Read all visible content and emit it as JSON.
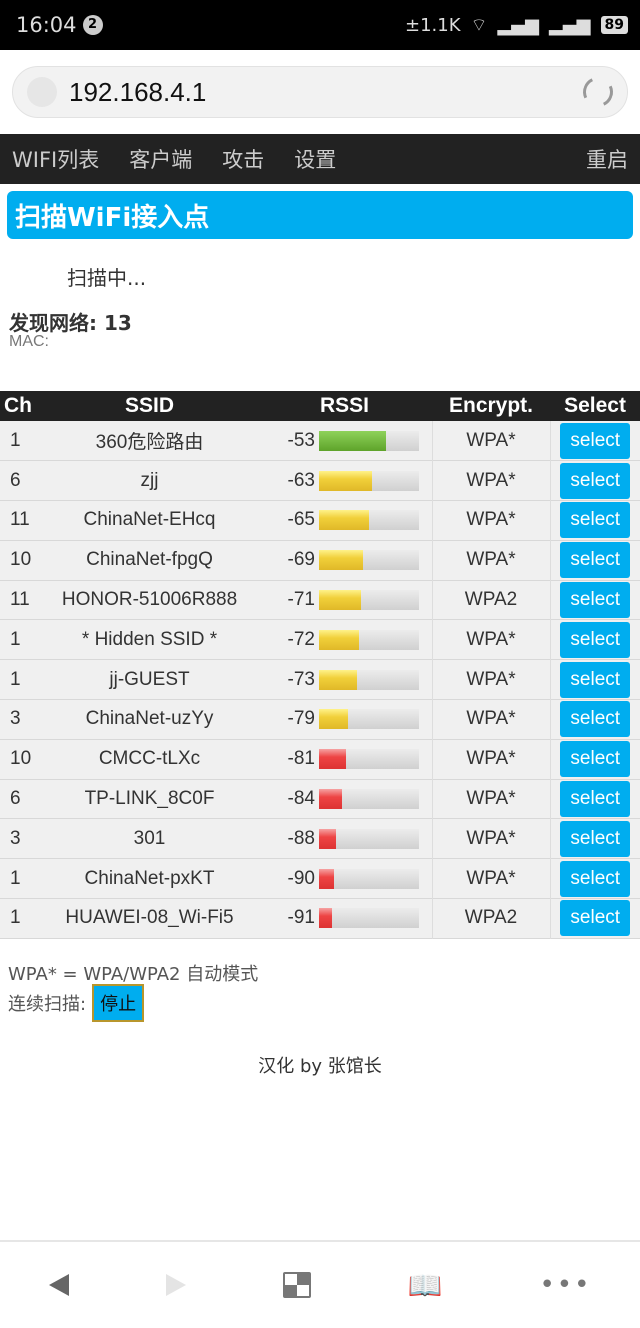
{
  "status_bar": {
    "time": "16:04",
    "notif_count": "2",
    "net_speed": "±1.1K",
    "battery": "89"
  },
  "browser": {
    "url": "192.168.4.1"
  },
  "nav": {
    "items": [
      "WIFI列表",
      "客户端",
      "攻击",
      "设置"
    ],
    "right": "重启"
  },
  "page": {
    "header": "扫描WiFi接入点",
    "scanning": "扫描中...",
    "found_label": "发现网络: 13",
    "mac_label": "MAC:"
  },
  "table": {
    "headers": [
      "Ch",
      "SSID",
      "RSSI",
      "Encrypt.",
      "Select"
    ],
    "select_label": "select",
    "rows": [
      {
        "ch": "1",
        "ssid": "360危险路由",
        "rssi": "-53",
        "fill_pct": 67,
        "level": "green",
        "enc": "WPA*"
      },
      {
        "ch": "6",
        "ssid": "zjj",
        "rssi": "-63",
        "fill_pct": 53,
        "level": "yellow",
        "enc": "WPA*"
      },
      {
        "ch": "11",
        "ssid": "ChinaNet-EHcq",
        "rssi": "-65",
        "fill_pct": 50,
        "level": "yellow",
        "enc": "WPA*"
      },
      {
        "ch": "10",
        "ssid": "ChinaNet-fpgQ",
        "rssi": "-69",
        "fill_pct": 44,
        "level": "yellow",
        "enc": "WPA*"
      },
      {
        "ch": "11",
        "ssid": "HONOR-51006R888",
        "rssi": "-71",
        "fill_pct": 42,
        "level": "yellow",
        "enc": "WPA2"
      },
      {
        "ch": "1",
        "ssid": "* Hidden SSID *",
        "rssi": "-72",
        "fill_pct": 40,
        "level": "yellow",
        "enc": "WPA*"
      },
      {
        "ch": "1",
        "ssid": "jj-GUEST",
        "rssi": "-73",
        "fill_pct": 38,
        "level": "yellow",
        "enc": "WPA*"
      },
      {
        "ch": "3",
        "ssid": "ChinaNet-uzYy",
        "rssi": "-79",
        "fill_pct": 29,
        "level": "yellow",
        "enc": "WPA*"
      },
      {
        "ch": "10",
        "ssid": "CMCC-tLXc",
        "rssi": "-81",
        "fill_pct": 27,
        "level": "red",
        "enc": "WPA*"
      },
      {
        "ch": "6",
        "ssid": "TP-LINK_8C0F",
        "rssi": "-84",
        "fill_pct": 23,
        "level": "red",
        "enc": "WPA*"
      },
      {
        "ch": "3",
        "ssid": "301",
        "rssi": "-88",
        "fill_pct": 17,
        "level": "red",
        "enc": "WPA*"
      },
      {
        "ch": "1",
        "ssid": "ChinaNet-pxKT",
        "rssi": "-90",
        "fill_pct": 15,
        "level": "red",
        "enc": "WPA*"
      },
      {
        "ch": "1",
        "ssid": "HUAWEI-08_Wi-Fi5",
        "rssi": "-91",
        "fill_pct": 13,
        "level": "red",
        "enc": "WPA2"
      }
    ]
  },
  "footer": {
    "legend": "WPA* = WPA/WPA2 自动模式",
    "continuous_label": "连续扫描:",
    "stop_button": "停止",
    "credit": "汉化 by 张馆长"
  },
  "bottom_bar": {
    "more": "•••"
  }
}
